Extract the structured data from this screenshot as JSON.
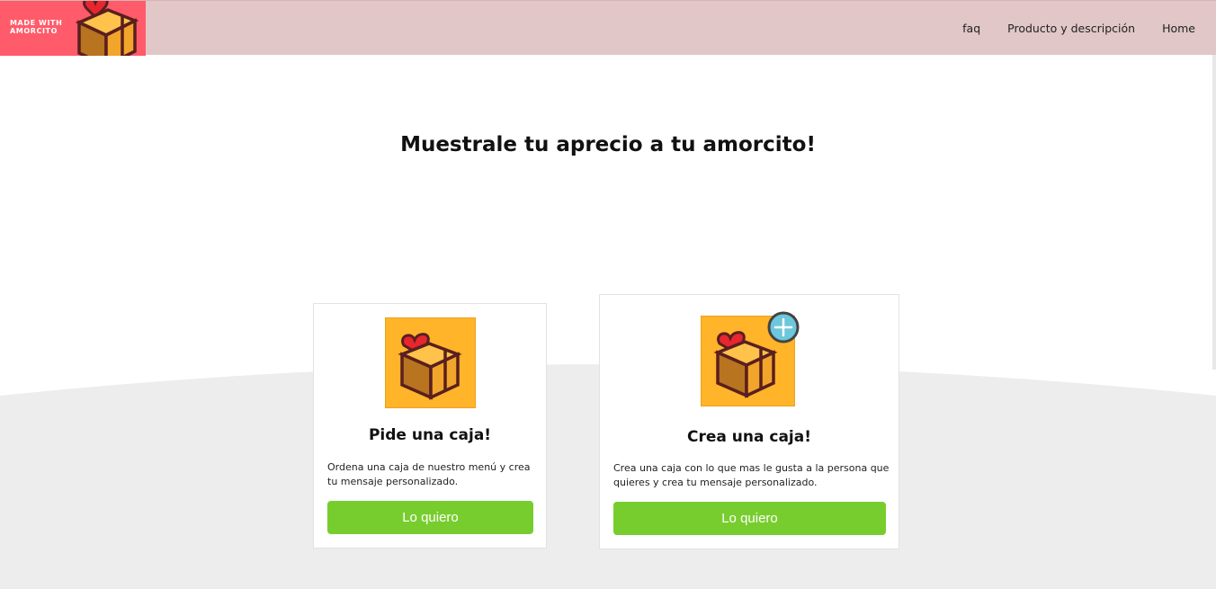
{
  "header": {
    "logo_text": "MADE WITH AMORCITO",
    "logo_icon": "gift-box-heart-icon",
    "nav": [
      {
        "label": "faq"
      },
      {
        "label": "Producto y descripción"
      },
      {
        "label": "Home"
      }
    ]
  },
  "hero": {
    "title": "Muestrale tu aprecio a tu amorcito!"
  },
  "cards": [
    {
      "icon": "gift-box-heart-icon",
      "title": "Pide una caja!",
      "description": "Ordena una caja de nuestro menú y crea tu mensaje personalizado.",
      "button_label": "Lo quiero"
    },
    {
      "icon": "gift-box-heart-icon",
      "badge_icon": "plus-circle-icon",
      "title": "Crea una caja!",
      "description": "Crea una caja con lo que mas le gusta a la persona que quieres y crea tu mensaje personalizado.",
      "button_label": "Lo quiero"
    }
  ],
  "colors": {
    "header_bg": "#e1c7c7",
    "logo_bg": "#ff5b6a",
    "button_bg": "#78cd2e",
    "card_image_bg": "#ffb429",
    "wave_bg": "#ededed"
  }
}
